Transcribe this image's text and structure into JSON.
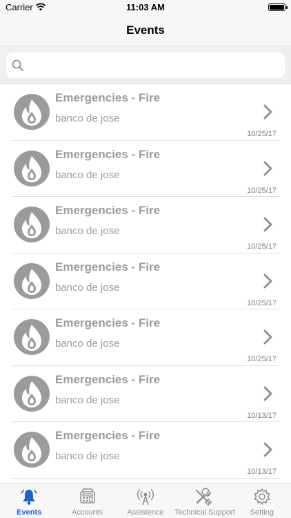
{
  "status_bar": {
    "carrier": "Carrier",
    "time": "11:03 AM"
  },
  "nav": {
    "title": "Events"
  },
  "search": {
    "placeholder": "",
    "value": ""
  },
  "events": [
    {
      "title": "Emergencies - Fire",
      "subtitle": "banco de jose",
      "date": "10/25/17",
      "icon": "fire-icon"
    },
    {
      "title": "Emergencies - Fire",
      "subtitle": "banco de jose",
      "date": "10/25/17",
      "icon": "fire-icon"
    },
    {
      "title": "Emergencies - Fire",
      "subtitle": "banco de jose",
      "date": "10/25/17",
      "icon": "fire-icon"
    },
    {
      "title": "Emergencies - Fire",
      "subtitle": "banco de jose",
      "date": "10/25/17",
      "icon": "fire-icon"
    },
    {
      "title": "Emergencies - Fire",
      "subtitle": "banco de jose",
      "date": "10/25/17",
      "icon": "fire-icon"
    },
    {
      "title": "Emergencies - Fire",
      "subtitle": "banco de jose",
      "date": "10/13/17",
      "icon": "fire-icon"
    },
    {
      "title": "Emergencies - Fire",
      "subtitle": "banco de jose",
      "date": "10/13/17",
      "icon": "fire-icon"
    }
  ],
  "tabbar": {
    "items": [
      {
        "label": "Events",
        "icon": "bell-icon",
        "active": true
      },
      {
        "label": "Accounts",
        "icon": "accounts-icon",
        "active": false
      },
      {
        "label": "Assistence",
        "icon": "signal-tower-icon",
        "active": false
      },
      {
        "label": "Technical Support",
        "icon": "tools-icon",
        "active": false
      },
      {
        "label": "Setting",
        "icon": "gear-icon",
        "active": false
      }
    ]
  },
  "colors": {
    "accent": "#1f62c9",
    "row_text": "#9b9b9b",
    "icon_bg": "#9b9b9b",
    "bar_bg": "#f7f7f7"
  }
}
